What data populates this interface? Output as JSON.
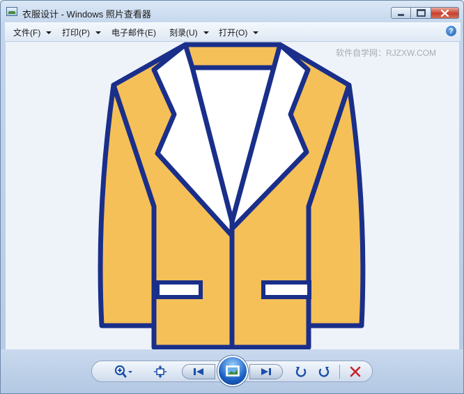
{
  "window": {
    "title": "衣服设计 - Windows 照片查看器",
    "icon": "photo-viewer-icon"
  },
  "menu": {
    "items": [
      {
        "label": "文件(F)",
        "has_dropdown": true
      },
      {
        "label": "打印(P)",
        "has_dropdown": true
      },
      {
        "label": "电子邮件(E)",
        "has_dropdown": false
      },
      {
        "label": "刻录(U)",
        "has_dropdown": true
      },
      {
        "label": "打开(O)",
        "has_dropdown": true
      }
    ],
    "help_glyph": "?"
  },
  "viewer": {
    "watermark": "软件自学网：RJZXW.COM",
    "image": {
      "subject": "jacket-illustration",
      "colors": {
        "body": "#f5c057",
        "collar": "#ffffff",
        "outline": "#1a2f8a"
      }
    }
  },
  "controls": {
    "zoom_icon": "zoom-icon",
    "fit_icon": "actual-size-icon",
    "prev_icon": "previous-icon",
    "slideshow_icon": "slideshow-icon",
    "next_icon": "next-icon",
    "rotate_ccw_icon": "rotate-counterclockwise-icon",
    "rotate_cw_icon": "rotate-clockwise-icon",
    "delete_icon": "delete-icon"
  },
  "colors": {
    "accent": "#1b61c4",
    "delete": "#c8252b"
  }
}
